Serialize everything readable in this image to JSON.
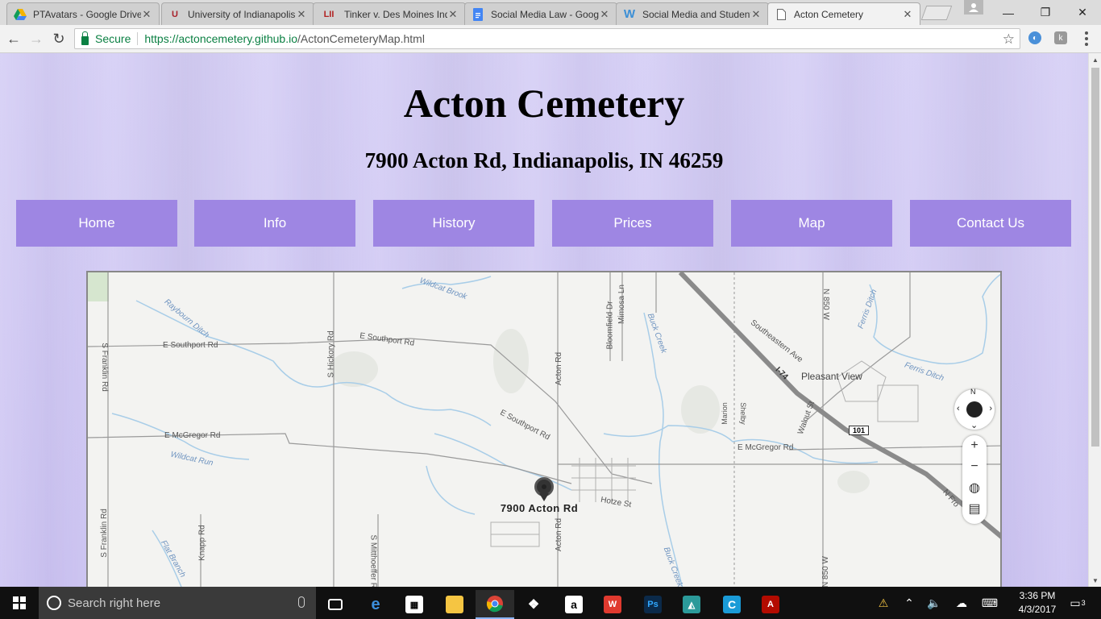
{
  "browser": {
    "tabs": [
      {
        "label": "PTAvatars - Google Drive",
        "icon": "google-drive-icon",
        "active": false
      },
      {
        "label": "University of Indianapolis",
        "icon": "uindy-icon",
        "active": false
      },
      {
        "label": "Tinker v. Des Moines Ind",
        "icon": "lii-icon",
        "icon_text": "LII",
        "active": false
      },
      {
        "label": "Social Media Law - Google",
        "icon": "google-docs-icon",
        "active": false
      },
      {
        "label": "Social Media and Student",
        "icon": "wikipedia-icon",
        "icon_text": "W",
        "active": false
      },
      {
        "label": "Acton Cemetery",
        "icon": "page-icon",
        "active": true
      }
    ],
    "omnibox": {
      "secure_label": "Secure",
      "url_host": "https://actoncemetery.github.io",
      "url_path": "/ActonCemeteryMap.html"
    }
  },
  "page": {
    "title": "Acton Cemetery",
    "address": "7900 Acton Rd, Indianapolis, IN 46259",
    "nav": [
      "Home",
      "Info",
      "History",
      "Prices",
      "Map",
      "Contact Us"
    ],
    "nav_color": "#9e86e3",
    "background_color": "#cfc7f3"
  },
  "map": {
    "pin_label": "7900 Acton Rd",
    "roads": [
      "E Southport Rd",
      "E Southport Rd",
      "E Southport Rd",
      "E McGregor Rd",
      "E McGregor Rd",
      "S Franklin Rd",
      "S Franklin Rd",
      "S Hickory Rd",
      "Acton Rd",
      "Acton Rd",
      "Bloomfield Dr",
      "Mimosa Ln",
      "Knapp Rd",
      "S Mitthoeffer Rd",
      "Hotze St",
      "Southeastern Ave",
      "Walnut St",
      "N 850 W",
      "N 850 W",
      "N Fro"
    ],
    "water": [
      "Wildcat Brook",
      "Raybourn Ditch",
      "Wildcat Run",
      "Buck Creek",
      "Buck Creek",
      "Ferris Ditch",
      "Ferris Ditch",
      "Flat Branch"
    ],
    "places": [
      "Pleasant View"
    ],
    "counties": [
      "Marion",
      "Shelby"
    ],
    "interstate": "I-74",
    "route_shield": "101",
    "compass_north": "N",
    "zoom_in": "+",
    "zoom_out": "−"
  },
  "taskbar": {
    "search_placeholder": "Search right here",
    "time": "3:36 PM",
    "date": "4/3/2017",
    "notifications": "3"
  }
}
